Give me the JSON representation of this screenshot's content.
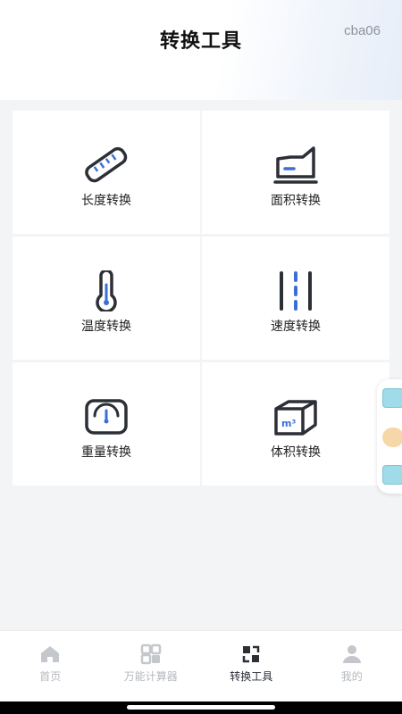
{
  "header": {
    "title": "转换工具",
    "user_tag": "cba06"
  },
  "tools": [
    {
      "label": "长度转换",
      "icon": "ruler-icon"
    },
    {
      "label": "面积转换",
      "icon": "area-chart-icon"
    },
    {
      "label": "温度转换",
      "icon": "thermometer-icon"
    },
    {
      "label": "速度转换",
      "icon": "speed-lines-icon"
    },
    {
      "label": "重量转换",
      "icon": "scale-icon"
    },
    {
      "label": "体积转换",
      "icon": "volume-cube-icon"
    }
  ],
  "tabbar": {
    "items": [
      {
        "label": "首页",
        "icon": "home-icon",
        "active": false
      },
      {
        "label": "万能计算器",
        "icon": "calculator-grid-icon",
        "active": false
      },
      {
        "label": "转换工具",
        "icon": "convert-icon",
        "active": true
      },
      {
        "label": "我的",
        "icon": "person-icon",
        "active": false
      }
    ]
  },
  "colors": {
    "accent": "#3b6fd6",
    "icon_dark": "#2b2f36",
    "background": "#f3f4f6"
  }
}
